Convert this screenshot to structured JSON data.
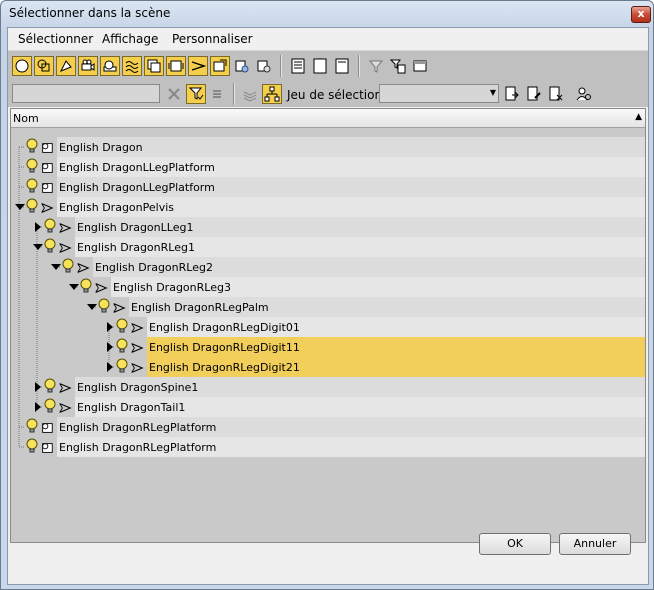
{
  "window": {
    "title": "Sélectionner dans la scène",
    "close_glyph": "x"
  },
  "menu": [
    "Sélectionner",
    "Affichage",
    "Personnaliser"
  ],
  "toolbar2": {
    "selection_set_label": "Jeu de sélection:",
    "search_value": "",
    "selection_set_value": ""
  },
  "tree": {
    "column_header": "Nom",
    "rows": [
      {
        "name": "English Dragon",
        "type": "geometry",
        "depth": 0,
        "expander": "none",
        "highlighted": false
      },
      {
        "name": "English DragonLLegPlatform",
        "type": "geometry",
        "depth": 0,
        "expander": "none",
        "highlighted": false
      },
      {
        "name": "English DragonLLegPlatform",
        "type": "geometry",
        "depth": 0,
        "expander": "none",
        "highlighted": false
      },
      {
        "name": "English DragonPelvis",
        "type": "bone",
        "depth": 0,
        "expander": "expanded",
        "highlighted": false
      },
      {
        "name": "English DragonLLeg1",
        "type": "bone",
        "depth": 1,
        "expander": "collapsed",
        "highlighted": false
      },
      {
        "name": "English DragonRLeg1",
        "type": "bone",
        "depth": 1,
        "expander": "expanded",
        "highlighted": false
      },
      {
        "name": "English DragonRLeg2",
        "type": "bone",
        "depth": 2,
        "expander": "expanded",
        "highlighted": false
      },
      {
        "name": "English DragonRLeg3",
        "type": "bone",
        "depth": 3,
        "expander": "expanded",
        "highlighted": false
      },
      {
        "name": "English DragonRLegPalm",
        "type": "bone",
        "depth": 4,
        "expander": "expanded",
        "highlighted": false
      },
      {
        "name": "English DragonRLegDigit01",
        "type": "bone",
        "depth": 5,
        "expander": "collapsed",
        "highlighted": false
      },
      {
        "name": "English DragonRLegDigit11",
        "type": "bone",
        "depth": 5,
        "expander": "collapsed",
        "highlighted": true
      },
      {
        "name": "English DragonRLegDigit21",
        "type": "bone",
        "depth": 5,
        "expander": "collapsed",
        "highlighted": true
      },
      {
        "name": "English DragonSpine1",
        "type": "bone",
        "depth": 1,
        "expander": "collapsed",
        "highlighted": false
      },
      {
        "name": "English DragonTail1",
        "type": "bone",
        "depth": 1,
        "expander": "collapsed",
        "highlighted": false
      },
      {
        "name": "English DragonRLegPlatform",
        "type": "geometry",
        "depth": 0,
        "expander": "none",
        "highlighted": false
      },
      {
        "name": "English DragonRLegPlatform",
        "type": "geometry",
        "depth": 0,
        "expander": "none",
        "highlighted": false
      }
    ]
  },
  "buttons": {
    "ok": "OK",
    "cancel": "Annuler"
  },
  "colors": {
    "highlight": "#f2cf5a",
    "toggle_on": "#f5cf4c",
    "panel": "#c0c0c0"
  }
}
